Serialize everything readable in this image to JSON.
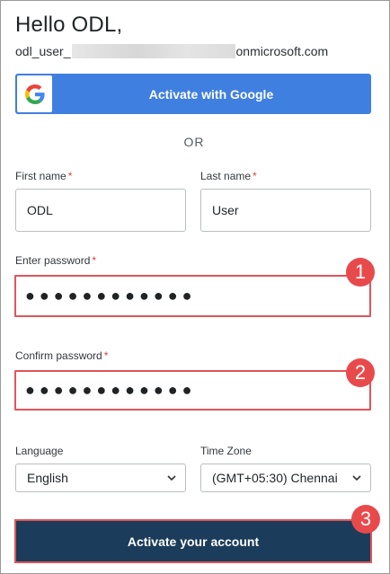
{
  "greeting": "Hello ODL,",
  "email": {
    "prefix": "odl_user_",
    "suffix": "onmicrosoft.com"
  },
  "google_button": {
    "label": "Activate with Google",
    "icon": "google-logo-icon",
    "color": "#3f7fe0"
  },
  "divider_text": "OR",
  "first_name": {
    "label": "First name",
    "required_mark": "*",
    "value": "ODL"
  },
  "last_name": {
    "label": "Last name",
    "required_mark": "*",
    "value": "User"
  },
  "password": {
    "label": "Enter password",
    "required_mark": "*",
    "value_masked": "●●●●●●●●●●●●"
  },
  "confirm_password": {
    "label": "Confirm password",
    "required_mark": "*",
    "value_masked": "●●●●●●●●●●●●"
  },
  "language": {
    "label": "Language",
    "selected": "English"
  },
  "timezone": {
    "label": "Time Zone",
    "selected": "(GMT+05:30) Chennai"
  },
  "activate_button": {
    "label": "Activate your account",
    "color": "#1b3c5a"
  },
  "callouts": [
    "1",
    "2",
    "3"
  ],
  "colors": {
    "required": "#d94040",
    "callout": "#e84a4c",
    "highlight_border": "#e0555a"
  }
}
